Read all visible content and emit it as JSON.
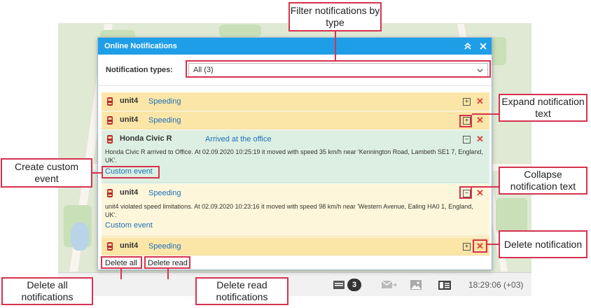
{
  "window": {
    "title": "Online Notifications",
    "collapse_icon": "double-chevron-up-icon",
    "close_icon": "close-icon"
  },
  "filter": {
    "label": "Notification types:",
    "value": "All (3)"
  },
  "notifications": [
    {
      "unit": "unit4",
      "type": "Speeding",
      "state": "collapsed"
    },
    {
      "unit": "unit4",
      "type": "Speeding",
      "state": "collapsed"
    },
    {
      "unit": "Honda Civic R",
      "type": "Arrived at the office",
      "state": "expanded",
      "message": "Honda Civic R arrived to Office. At 02.09.2020 10:25:19 it moved with speed 35 km/h near 'Kennington Road, Lambeth SE1 7, England, UK'.",
      "link": "Custom event"
    },
    {
      "unit": "unit4",
      "type": "Speeding",
      "state": "expanded",
      "message": "unit4 violated speed limitations. At 02.09.2020 10:23:16 it moved with speed 98 km/h near 'Western Avenue, Ealing HA0 1, England, UK'.",
      "link": "Custom event"
    },
    {
      "unit": "unit4",
      "type": "Speeding",
      "state": "collapsed"
    }
  ],
  "footer": {
    "delete_all": "Delete all",
    "delete_read": "Delete read"
  },
  "statusbar": {
    "notifications_count": "3",
    "time": "18:29:06 (+03)"
  },
  "callouts": {
    "filter": "Filter notifications by type",
    "expand": "Expand notification text",
    "custom": "Create custom event",
    "collapse": "Collapse notification text",
    "delete": "Delete notification",
    "delete_all": "Delete all notifications",
    "delete_read": "Delete read notifications"
  },
  "colors": {
    "titlebar": "#1f9ee8",
    "highlight": "#d7324f",
    "row_unread": "#fbe6a8",
    "row_read": "#fdf6da",
    "row_green": "#dcefe2"
  }
}
